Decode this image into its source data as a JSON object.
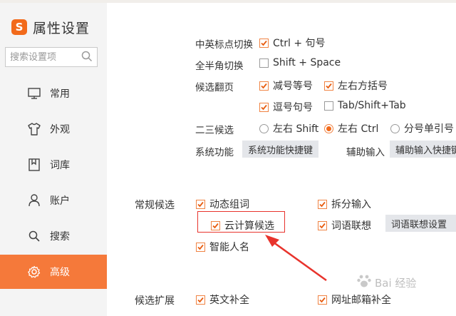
{
  "app": {
    "title": "属性设置",
    "logo_letter": "S"
  },
  "search": {
    "placeholder": "搜索设置项"
  },
  "sidebar": {
    "items": [
      {
        "label": "常用",
        "icon": "monitor-icon"
      },
      {
        "label": "外观",
        "icon": "shirt-icon"
      },
      {
        "label": "词库",
        "icon": "dictionary-icon"
      },
      {
        "label": "账户",
        "icon": "user-icon"
      },
      {
        "label": "搜索",
        "icon": "magnifier-icon"
      },
      {
        "label": "高级",
        "icon": "gear-icon",
        "active": true
      }
    ]
  },
  "settings": {
    "cn_en_punct": {
      "label": "中英标点切换",
      "option": "Ctrl + 句号",
      "checked": true
    },
    "full_half": {
      "label": "全半角切换",
      "option": "Shift + Space",
      "checked": false
    },
    "page_turn": {
      "label": "候选翻页",
      "options": [
        {
          "label": "减号等号",
          "checked": true
        },
        {
          "label": "左右方括号",
          "checked": true
        },
        {
          "label": "逗号句号",
          "checked": true
        },
        {
          "label": "Tab/Shift+Tab",
          "checked": false
        }
      ]
    },
    "second_third": {
      "label": "二三候选",
      "options": [
        {
          "label": "左右 Shift",
          "selected": false
        },
        {
          "label": "左右 Ctrl",
          "selected": true
        },
        {
          "label": "分号单引号",
          "selected": false
        }
      ]
    },
    "system_func": {
      "label": "系统功能",
      "button": "系统功能快捷键"
    },
    "aux_input": {
      "label": "辅助输入",
      "button": "辅助输入快捷键"
    },
    "regular_candidates": {
      "label": "常规候选",
      "dynamic_combo": "动态组词",
      "split_input": "拆分输入",
      "cloud_candidates": "云计算候选",
      "word_association": "词语联想",
      "association_button": "词语联想设置",
      "smart_names": "智能人名"
    },
    "candidate_extend": {
      "label": "候选扩展",
      "english_complete": "英文补全",
      "url_email_complete": "网址邮箱补全"
    }
  },
  "watermark": {
    "text": "Bai 经验",
    "sub": "du"
  },
  "colors": {
    "accent": "#f26a1b",
    "active_nav": "#f5793a",
    "highlight_box": "#e8332c",
    "button_bg": "#e4e6ea"
  }
}
